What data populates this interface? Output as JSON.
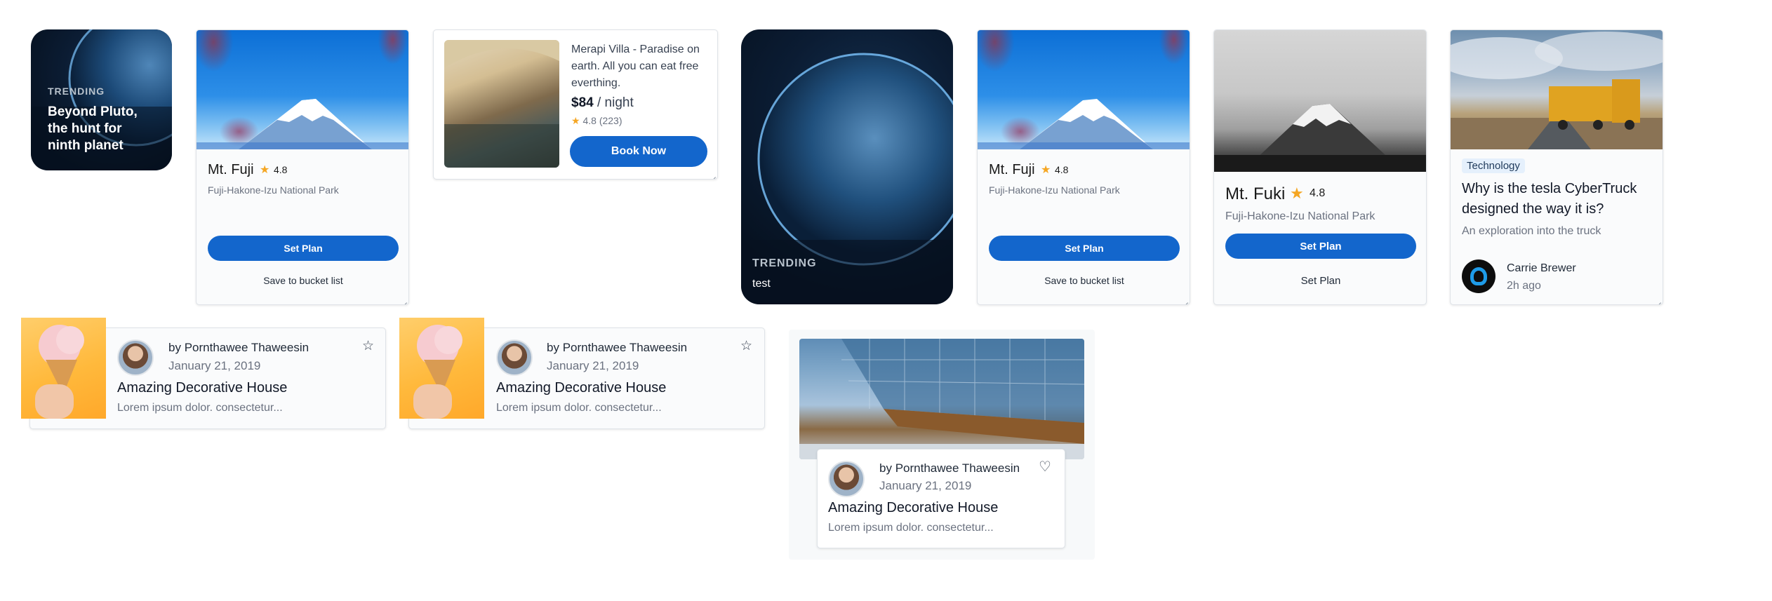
{
  "trending_small": {
    "tag": "TRENDING",
    "title": "Beyond Pluto, the hunt for ninth planet"
  },
  "fuji_card_1": {
    "name": "Mt. Fuji",
    "rating": "4.8",
    "location": "Fuji-Hakone-Izu National Park",
    "primary_button": "Set Plan",
    "secondary_button": "Save to bucket list"
  },
  "villa_card": {
    "description": "Merapi Villa - Paradise on earth. All you can eat free everthing.",
    "price": "$84",
    "price_unit": "/ night",
    "rating": "4.8",
    "reviews": "(223)",
    "button": "Book Now"
  },
  "trending_large": {
    "tag": "TRENDING",
    "title": "test"
  },
  "fuji_card_2": {
    "name": "Mt. Fuji",
    "rating": "4.8",
    "location": "Fuji-Hakone-Izu National Park",
    "primary_button": "Set Plan",
    "secondary_button": "Save to bucket list"
  },
  "fuki_card": {
    "name": "Mt. Fuki",
    "rating": "4.8",
    "location": "Fuji-Hakone-Izu National Park",
    "primary_button": "Set Plan",
    "secondary_button": "Set Plan"
  },
  "article_card": {
    "category": "Technology",
    "title": "Why is the tesla CyberTruck designed the way it is?",
    "subtitle": "An exploration into the truck",
    "author": "Carrie Brewer",
    "time": "2h ago"
  },
  "post_cards": [
    {
      "by": "by",
      "author": "Pornthawee Thaweesin",
      "date": "January 21, 2019",
      "title": "Amazing Decorative House",
      "excerpt": "Lorem ipsum dolor. consectetur..."
    },
    {
      "by": "by",
      "author": "Pornthawee Thaweesin",
      "date": "January 21, 2019",
      "title": "Amazing Decorative House",
      "excerpt": "Lorem ipsum dolor. consectetur..."
    },
    {
      "by": "by",
      "author": "Pornthawee Thaweesin",
      "date": "January 21, 2019",
      "title": "Amazing Decorative House",
      "excerpt": "Lorem ipsum dolor. consectetur..."
    }
  ],
  "icons": {
    "rating": "star-icon",
    "favorite_outline": "star-outline-icon",
    "favorite_heart": "heart-outline-icon"
  },
  "colors": {
    "primary_button": "#1366cc",
    "star": "#f5a623",
    "trending_bg": "#0b1c33"
  }
}
